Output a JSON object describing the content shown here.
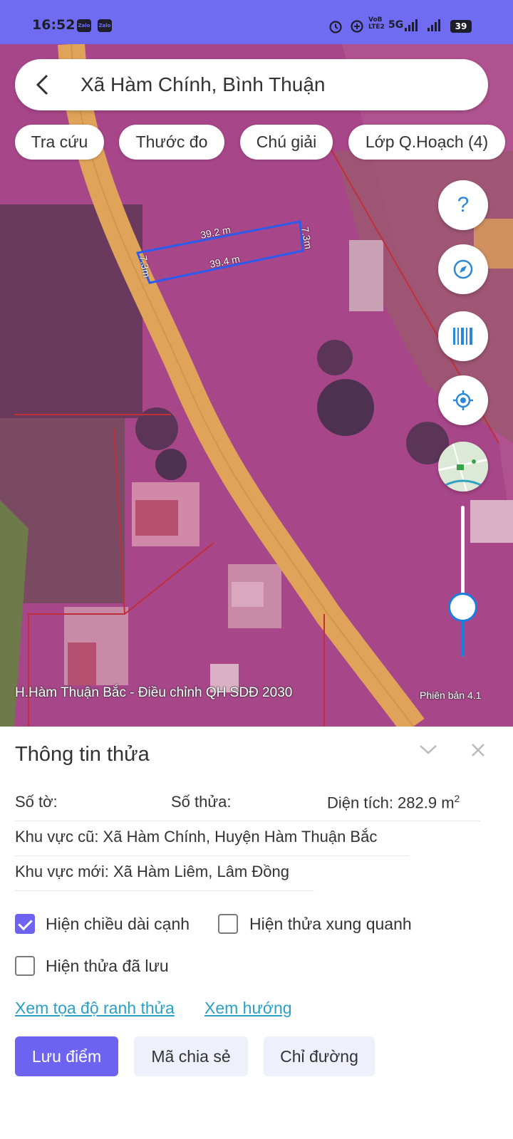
{
  "status_bar": {
    "time": "16:52",
    "notifications": [
      "Zalo",
      "Zalo"
    ],
    "network_label_top": "VoB",
    "network_label_bottom": "LTE2",
    "network_type": "5G",
    "battery": "39",
    "icons": [
      "alarm-icon",
      "data-saver-icon",
      "signal-icon",
      "signal-icon"
    ]
  },
  "search": {
    "back_icon": "chevron-left-icon",
    "location": "Xã Hàm Chính, Bình Thuận"
  },
  "toolbar": {
    "chips": [
      {
        "label": "Tra cứu"
      },
      {
        "label": "Thước đo"
      },
      {
        "label": "Chú giải"
      },
      {
        "label": "Lớp Q.Hoạch (4)"
      }
    ]
  },
  "map": {
    "measurements": {
      "top_edge": "39.2 m",
      "bottom_edge": "39.4 m",
      "left_edge": "7.3m",
      "right_edge": "7.3m"
    },
    "caption": "H.Hàm Thuận Bắc - Điều chỉnh QH SDĐ 2030",
    "version": "Phiên bản 4.1",
    "side_buttons": [
      "help-icon",
      "compass-icon",
      "barcode-icon",
      "locate-icon",
      "minimap-thumbnail"
    ],
    "zoom_level": 0.34,
    "colors": {
      "overlay": "#b04b8f",
      "road": "#e0a35a",
      "parcel_line": "#2a5cf0"
    }
  },
  "panel": {
    "title": "Thông tin thửa",
    "so_to_label": "Số tờ:",
    "so_thua_label": "Số thửa:",
    "dien_tich_label": "Diện tích: 282.9 m",
    "dien_tich_sup": "2",
    "khu_vuc_cu": "Khu vực cũ: Xã Hàm Chính, Huyện Hàm Thuận Bắc",
    "khu_vuc_moi": "Khu vực mới: Xã Hàm Liêm, Lâm Đồng",
    "checkboxes": [
      {
        "label": "Hiện chiều dài cạnh",
        "checked": true
      },
      {
        "label": "Hiện thửa xung quanh",
        "checked": false
      },
      {
        "label": "Hiện thửa đã lưu",
        "checked": false
      }
    ],
    "links": [
      "Xem tọa độ ranh thửa",
      "Xem hướng"
    ],
    "buttons": {
      "save": "Lưu điểm",
      "share": "Mã chia sẻ",
      "directions": "Chỉ đường"
    }
  },
  "theme": {
    "accent": "#6c63f0",
    "link": "#2aa0c8",
    "status_bar": "#6f6cf2"
  }
}
